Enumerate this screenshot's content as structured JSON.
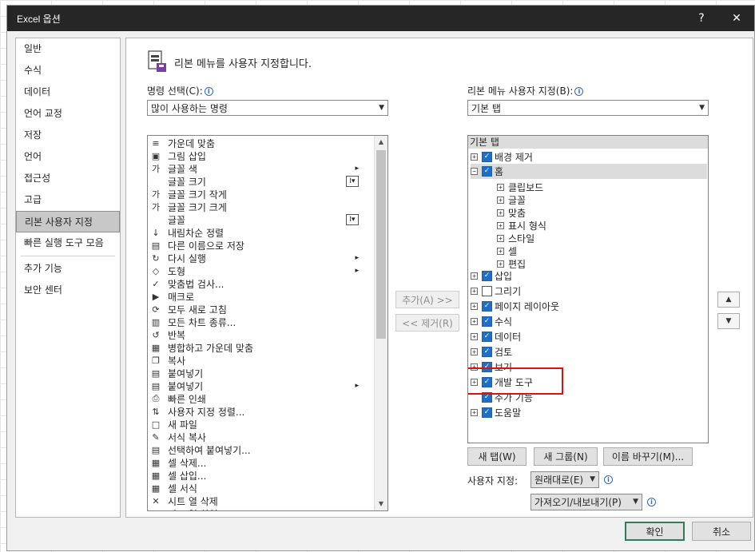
{
  "window": {
    "title": "Excel 옵션",
    "help_glyph": "?",
    "close_glyph": "✕"
  },
  "categories": [
    {
      "label": "일반"
    },
    {
      "label": "수식"
    },
    {
      "label": "데이터"
    },
    {
      "label": "언어 교정"
    },
    {
      "label": "저장"
    },
    {
      "label": "언어"
    },
    {
      "label": "접근성"
    },
    {
      "label": "고급"
    },
    {
      "label": "리본 사용자 지정"
    },
    {
      "label": "빠른 실행 도구 모음"
    },
    {
      "label": "추가 기능"
    },
    {
      "label": "보안 센터"
    }
  ],
  "header": {
    "text": "리본 메뉴를 사용자 지정합니다."
  },
  "left": {
    "label": "명령 선택(C):",
    "combo_value": "많이 사용하는 명령",
    "commands": [
      {
        "label": "가운데 맞춤",
        "icon": "≡"
      },
      {
        "label": "그림 삽입",
        "icon": "▣"
      },
      {
        "label": "글꼴 색",
        "icon": "가",
        "right": "▸"
      },
      {
        "label": "글꼴 크기",
        "icon": "",
        "right": "I▾"
      },
      {
        "label": "글꼴 크기 작게",
        "icon": "가"
      },
      {
        "label": "글꼴 크기 크게",
        "icon": "가"
      },
      {
        "label": "글꼴",
        "icon": "",
        "right": "I▾"
      },
      {
        "label": "내림차순 정렬",
        "icon": "↓"
      },
      {
        "label": "다른 이름으로 저장",
        "icon": "▤"
      },
      {
        "label": "다시 실행",
        "icon": "↻",
        "right": "▸"
      },
      {
        "label": "도형",
        "icon": "◇",
        "right": "▸"
      },
      {
        "label": "맞춤법 검사...",
        "icon": "✓"
      },
      {
        "label": "매크로",
        "icon": "▶"
      },
      {
        "label": "모두 새로 고침",
        "icon": "⟳"
      },
      {
        "label": "모든 차트 종류...",
        "icon": "▥"
      },
      {
        "label": "반복",
        "icon": "↺"
      },
      {
        "label": "병합하고 가운데 맞춤",
        "icon": "▦"
      },
      {
        "label": "복사",
        "icon": "❐"
      },
      {
        "label": "붙여넣기",
        "icon": "▤"
      },
      {
        "label": "붙여넣기",
        "icon": "▤",
        "right": "▸"
      },
      {
        "label": "빠른 인쇄",
        "icon": "⎙"
      },
      {
        "label": "사용자 지정 정렬...",
        "icon": "⇅"
      },
      {
        "label": "새 파일",
        "icon": "□"
      },
      {
        "label": "서식 복사",
        "icon": "✎"
      },
      {
        "label": "선택하여 붙여넣기...",
        "icon": "▤"
      },
      {
        "label": "셀 삭제...",
        "icon": "▦"
      },
      {
        "label": "셀 삽입...",
        "icon": "▦"
      },
      {
        "label": "셀 서식",
        "icon": "▦"
      },
      {
        "label": "시트 열 삭제",
        "icon": "✕"
      },
      {
        "label": "시트 열 삽입",
        "icon": "▥"
      }
    ]
  },
  "mid": {
    "add_label": "추가(A) >>",
    "remove_label": "<< 제거(R)"
  },
  "right": {
    "label": "리본 메뉴 사용자 지정(B):",
    "combo_value": "기본 탭",
    "tree_header": "기본 탭",
    "nodes": [
      {
        "label": "배경 제거",
        "exp": "+",
        "checked": true,
        "level": 0
      },
      {
        "label": "홈",
        "exp": "−",
        "checked": true,
        "level": 0,
        "highlight": true
      },
      {
        "label": "클립보드",
        "exp": "+",
        "level": 1
      },
      {
        "label": "글꼴",
        "exp": "+",
        "level": 1
      },
      {
        "label": "맞춤",
        "exp": "+",
        "level": 1
      },
      {
        "label": "표시 형식",
        "exp": "+",
        "level": 1
      },
      {
        "label": "스타일",
        "exp": "+",
        "level": 1
      },
      {
        "label": "셀",
        "exp": "+",
        "level": 1
      },
      {
        "label": "편집",
        "exp": "+",
        "level": 1
      },
      {
        "label": "삽입",
        "exp": "+",
        "checked": true,
        "level": 0
      },
      {
        "label": "그리기",
        "exp": "+",
        "checked": false,
        "level": 0
      },
      {
        "label": "페이지 레이아웃",
        "exp": "+",
        "checked": true,
        "level": 0
      },
      {
        "label": "수식",
        "exp": "+",
        "checked": true,
        "level": 0
      },
      {
        "label": "데이터",
        "exp": "+",
        "checked": true,
        "level": 0
      },
      {
        "label": "검토",
        "exp": "+",
        "checked": true,
        "level": 0
      },
      {
        "label": "보기",
        "exp": "+",
        "checked": true,
        "level": 0
      },
      {
        "label": "개발 도구",
        "exp": "+",
        "checked": true,
        "level": 0
      },
      {
        "label": "추가 기능",
        "exp": "",
        "checked": true,
        "level": 0
      },
      {
        "label": "도움말",
        "exp": "+",
        "checked": true,
        "level": 0
      }
    ],
    "new_tab_label": "새 탭(W)",
    "new_group_label": "새 그룹(N)",
    "rename_label": "이름 바꾸기(M)...",
    "customize_label": "사용자 지정:",
    "reset_value": "원래대로(E)",
    "import_export_value": "가져오기/내보내기(P)",
    "move_up_glyph": "▲",
    "move_down_glyph": "▼"
  },
  "footer": {
    "ok_label": "확인",
    "cancel_label": "취소"
  },
  "colors": {
    "accent_check": "#1f6fc9",
    "highlight_box": "#e01010",
    "title_bar": "#262626"
  }
}
